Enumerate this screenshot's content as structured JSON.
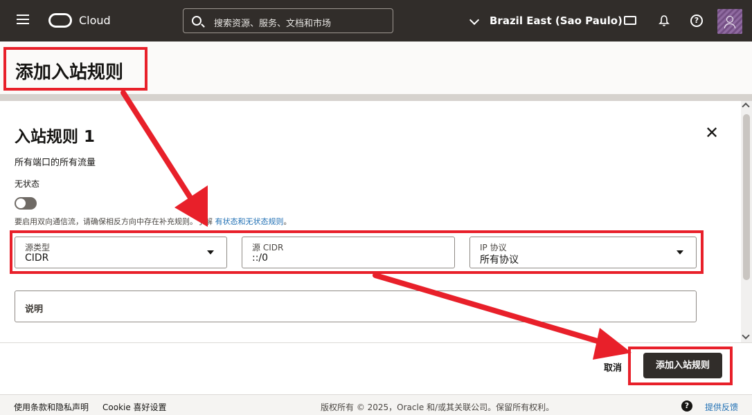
{
  "header": {
    "brand": "Cloud",
    "search_placeholder": "搜索资源、服务、文档和市场",
    "region": "Brazil East (Sao Paulo)"
  },
  "page": {
    "title": "添加入站规则"
  },
  "rule": {
    "title": "入站规则 1",
    "subtitle": "所有端口的所有流量",
    "stateless_label": "无状态",
    "stateless_on": false,
    "hint_text": "要启用双向通信流，请确保相反方向中存在补充规则。了解 ",
    "hint_link": "有状态和无状态规则",
    "hint_end": "。",
    "fields": {
      "source_type": {
        "label": "源类型",
        "value": "CIDR"
      },
      "source_cidr": {
        "label": "源 CIDR",
        "value": "::/0"
      },
      "ip_protocol": {
        "label": "IP 协议",
        "value": "所有协议"
      }
    },
    "description_label": "说明"
  },
  "actions": {
    "cancel": "取消",
    "add": "添加入站规则"
  },
  "footer": {
    "terms": "使用条款和隐私声明",
    "cookie": "Cookie 喜好设置",
    "copyright": "版权所有 © 2025，Oracle 和/或其关联公司。保留所有权利。",
    "feedback": "提供反馈"
  },
  "colors": {
    "header_bg": "#312d2a",
    "annotation_red": "#e8202a",
    "link_blue": "#1f6fb4"
  }
}
